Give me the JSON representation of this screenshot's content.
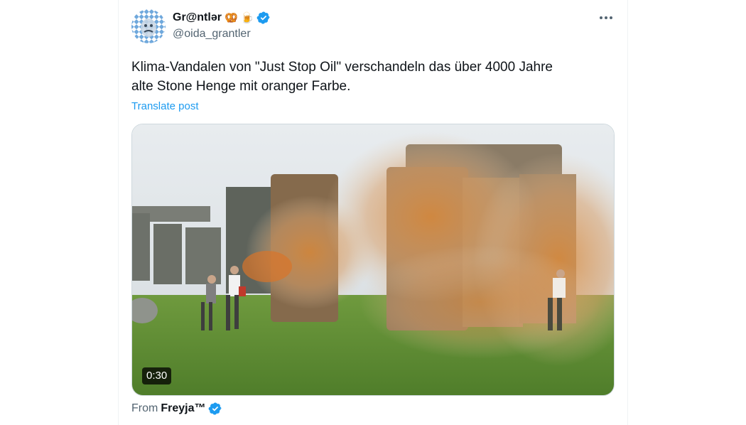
{
  "author": {
    "display_name": "Gr@ntlər",
    "emoji_1": "🥨",
    "emoji_2": "🍺",
    "handle": "@oida_grantler"
  },
  "post": {
    "text_line_1": "Klima-Vandalen von \"Just Stop Oil\" verschandeln das über 4000 Jahre",
    "text_line_2": "alte Stone Henge mit oranger Farbe.",
    "translate_label": "Translate post"
  },
  "media": {
    "duration": "0:30"
  },
  "attribution": {
    "prefix": "From",
    "source_name": "Freyja™"
  },
  "colors": {
    "link_blue": "#1d9bf0",
    "verified_blue": "#1d9bf0",
    "secondary_text": "#536471"
  },
  "icons": {
    "verified": "verified-badge-icon",
    "more": "more-dots-icon"
  }
}
